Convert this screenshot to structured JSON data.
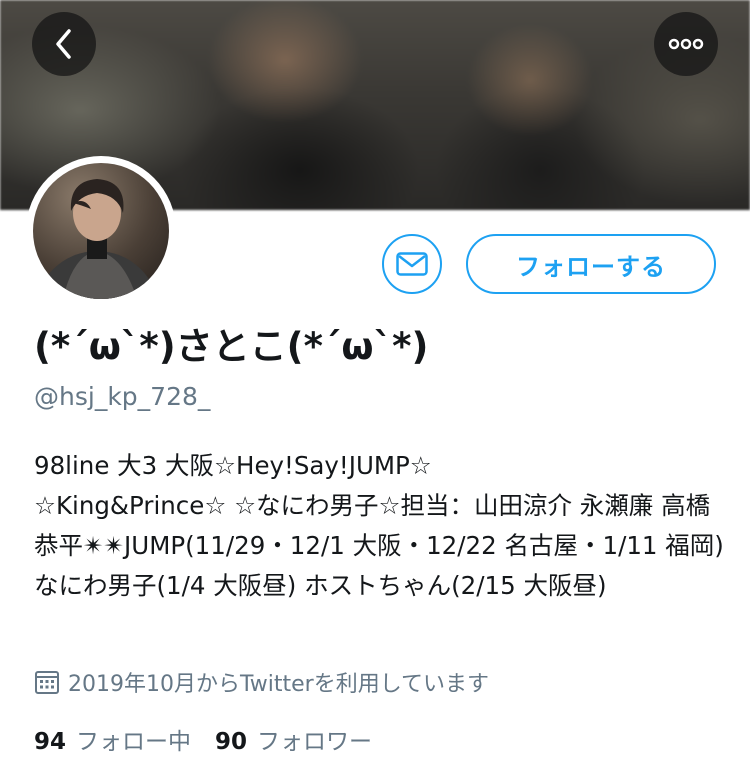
{
  "profile": {
    "display_name": "(*´ω`*)さとこ(*´ω`*)",
    "handle": "@hsj_kp_728_",
    "bio": "98line 大3 大阪☆Hey!Say!JUMP☆\n☆King&Prince☆ ☆なにわ男子☆担当：山田涼介 永瀬廉 高橋恭平✴︎✴︎JUMP(11/29・12/1 大阪・12/22 名古屋・1/11 福岡) なにわ男子(1/4 大阪昼) ホストちゃん(2/15 大阪昼)",
    "joined": "2019年10月からTwitterを利用しています"
  },
  "actions": {
    "follow_label": "フォローする",
    "back_icon": "chevron-left-icon",
    "more_icon": "more-horizontal-icon",
    "message_icon": "envelope-icon"
  },
  "stats": {
    "following_count": "94",
    "following_label": "フォロー中",
    "followers_count": "90",
    "followers_label": "フォロワー"
  },
  "colors": {
    "accent": "#1da1f2",
    "text_primary": "#14171a",
    "text_secondary": "#657786"
  }
}
